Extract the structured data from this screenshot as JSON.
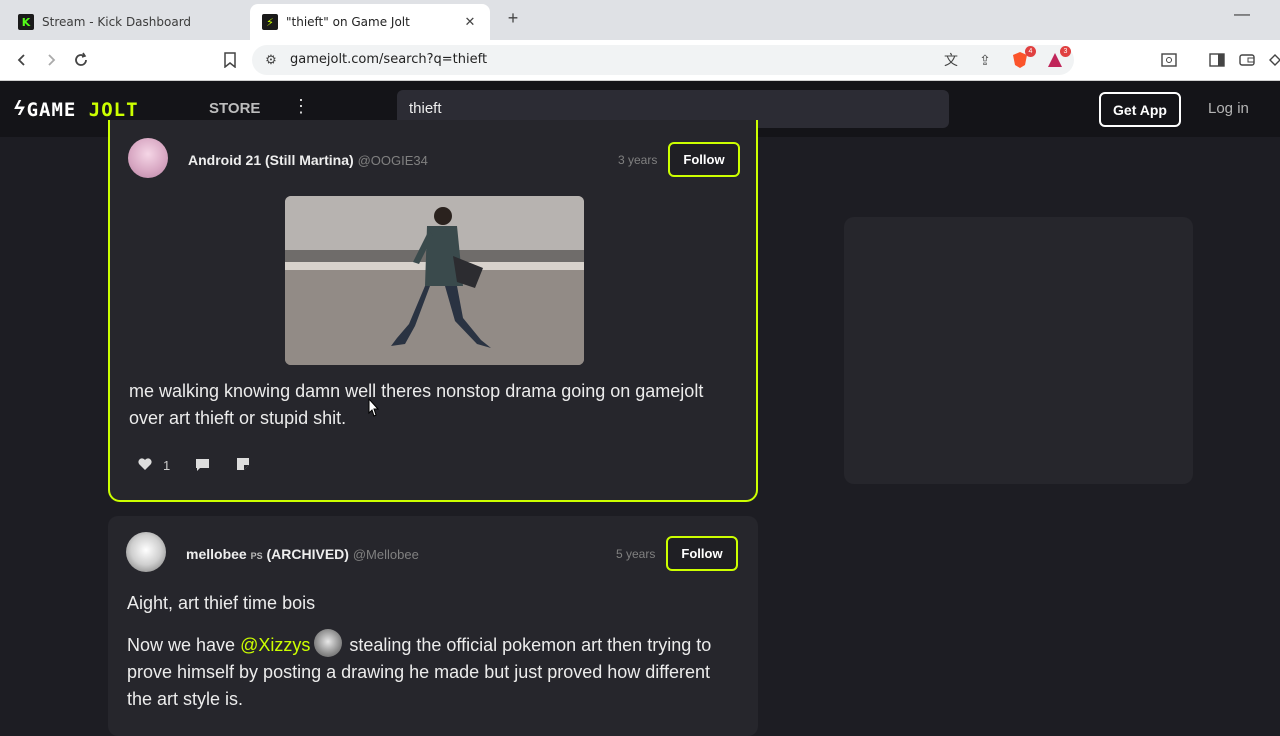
{
  "browser": {
    "tabs": [
      {
        "title": "Stream - Kick Dashboard",
        "icon": "kick-favicon-icon"
      },
      {
        "title": "\"thieft\" on Game Jolt",
        "icon": "gamejolt-favicon-icon"
      }
    ],
    "url": "gamejolt.com/search?q=thieft",
    "shield_badge": "4",
    "alert_badge": "3"
  },
  "header": {
    "logo_part1": "GAME ",
    "logo_part2": "JOLT",
    "store_label": "STORE",
    "search_value": "thieft",
    "get_app_label": "Get App",
    "login_label": "Log in"
  },
  "posts": [
    {
      "author": "Android 21 (Still Martina)",
      "handle": "@OOGIE34",
      "time": "3 years",
      "follow_label": "Follow",
      "text": "me walking knowing damn well theres nonstop drama going on gamejolt over art thieft or stupid shit.",
      "likes": "1"
    },
    {
      "author": "mellobee",
      "author_badge": "PS",
      "author_suffix": "(ARCHIVED)",
      "handle": "@Mellobee",
      "time": "5 years",
      "follow_label": "Follow",
      "line1": "Aight, art thief time bois",
      "line2_pre": "Now we have ",
      "line2_mention": "@Xizzys",
      "line2_post": " stealing the official pokemon art then trying to prove himself by posting a drawing he made but just proved how different the art style is."
    }
  ],
  "colors": {
    "accent": "#ccff00",
    "background": "#1d1d23",
    "card": "#26262c"
  }
}
